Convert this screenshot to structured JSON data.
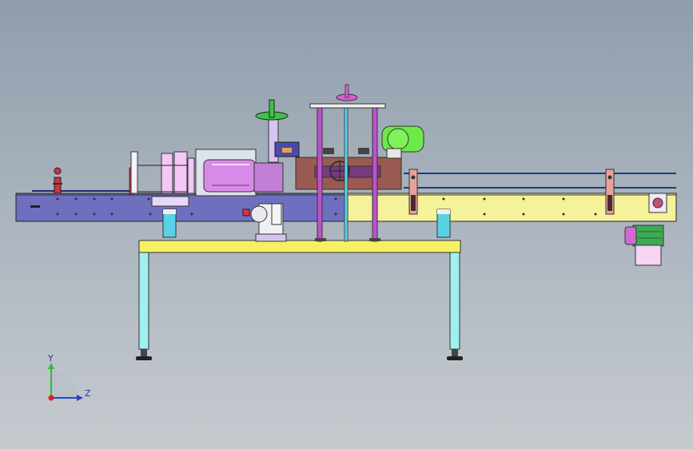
{
  "viewport": {
    "background_top": "#8f9dac",
    "background_bottom": "#c6cacf"
  },
  "colors": {
    "conveyor_blue": "#6f6fc0",
    "conveyor_yellow": "#f4f29a",
    "table_top": "#f7f062",
    "legs": "#9ff0ee",
    "posts_magenta": "#c050d0",
    "post_cyan": "#5ad2e6",
    "motor_violet": "#d98ae8",
    "blower_green": "#6de84a",
    "brown_head": "#9a5a52",
    "handwheel_green": "#3cc24a"
  },
  "triad": {
    "y_label": "Y",
    "z_label": "Z"
  }
}
